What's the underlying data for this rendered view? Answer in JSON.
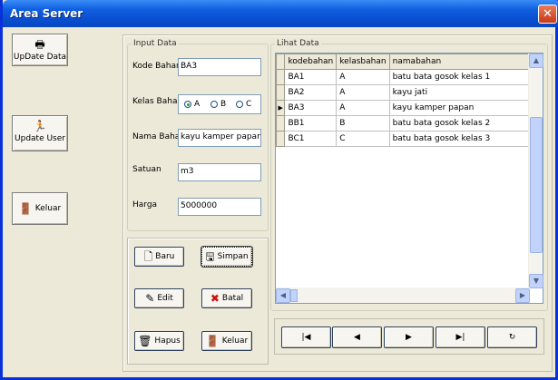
{
  "window": {
    "title": "Area Server",
    "close_glyph": "✕"
  },
  "sidebar": {
    "update_data": {
      "label": "UpDate Data",
      "icon": "printer-icon",
      "glyph": "🖶"
    },
    "update_user": {
      "label": "Update User",
      "icon": "user-run-icon",
      "glyph": "🏃"
    },
    "keluar": {
      "label": "Keluar",
      "icon": "exit-door-icon",
      "glyph": "🚪"
    }
  },
  "input": {
    "legend": "Input Data",
    "kode_bahan": {
      "label": "Kode Bahan",
      "value": "BA3"
    },
    "kelas_bahan": {
      "label": "Kelas Bahan",
      "options": [
        "A",
        "B",
        "C"
      ],
      "selected": "A"
    },
    "nama_bahan": {
      "label": "Nama Bahan",
      "value": "kayu kamper papan"
    },
    "satuan": {
      "label": "Satuan",
      "value": "m3"
    },
    "harga": {
      "label": "Harga",
      "value": "5000000"
    }
  },
  "actions": {
    "baru": {
      "label": "Baru",
      "icon": "new-document-icon",
      "glyph": "🗋"
    },
    "simpan": {
      "label": "Simpan",
      "icon": "save-icon",
      "glyph": "🖫"
    },
    "edit": {
      "label": "Edit",
      "icon": "edit-icon",
      "glyph": "✎"
    },
    "batal": {
      "label": "Batal",
      "icon": "cancel-x-icon",
      "glyph": "✖"
    },
    "hapus": {
      "label": "Hapus",
      "icon": "delete-icon",
      "glyph": "🗑"
    },
    "keluar": {
      "label": "Keluar",
      "icon": "exit-door-icon",
      "glyph": "🚪"
    }
  },
  "grid": {
    "legend": "Lihat Data",
    "columns": [
      "kodebahan",
      "kelasbahan",
      "namabahan"
    ],
    "rows": [
      [
        "BA1",
        "A",
        "batu bata gosok kelas 1"
      ],
      [
        "BA2",
        "A",
        "kayu jati"
      ],
      [
        "BA3",
        "A",
        "kayu kamper papan"
      ],
      [
        "BB1",
        "B",
        "batu bata gosok kelas 2"
      ],
      [
        "BC1",
        "C",
        "batu bata gosok kelas 3"
      ]
    ],
    "current_row_marker": "▶"
  },
  "nav": {
    "first": "|◀",
    "prev": "◀",
    "next": "▶",
    "last": "▶|",
    "refresh": "↻"
  },
  "colors": {
    "title_bar": "#0a4fd0",
    "face": "#ece9d8",
    "selected_radio": "#21a121"
  }
}
